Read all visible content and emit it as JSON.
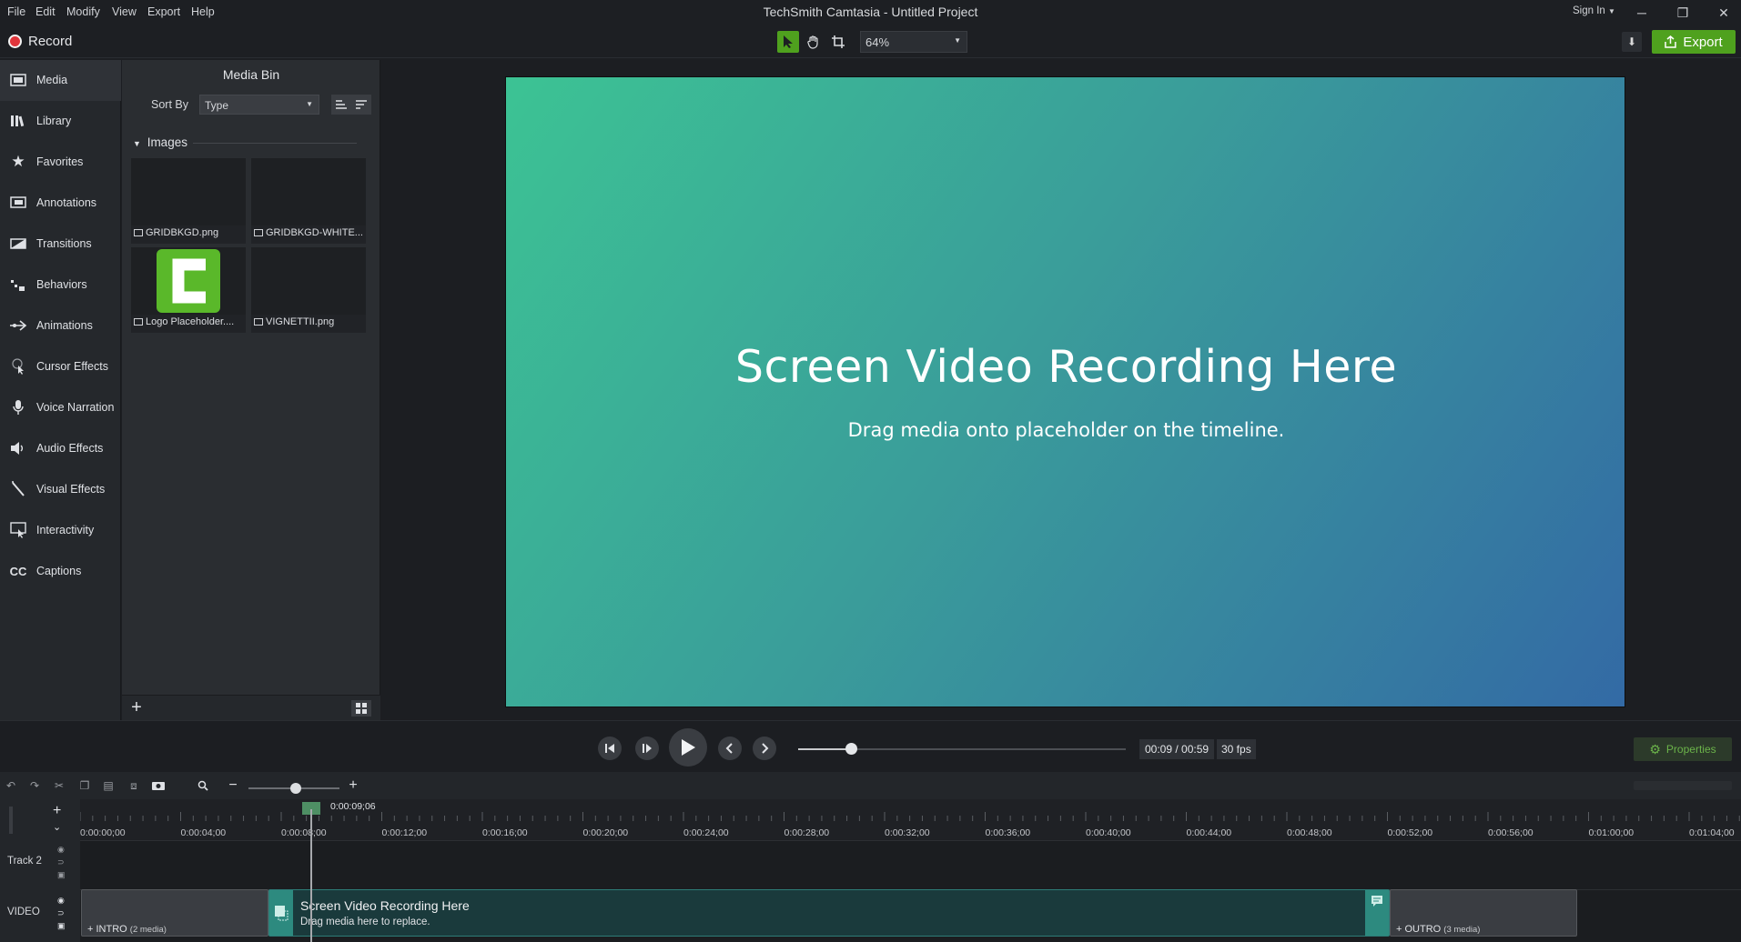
{
  "menu": [
    "File",
    "Edit",
    "Modify",
    "View",
    "Export",
    "Help"
  ],
  "app_title": "TechSmith Camtasia - Untitled Project",
  "sign_in": "Sign In",
  "record_label": "Record",
  "zoom_level": "64%",
  "export_label": "Export",
  "nav": [
    {
      "label": "Media",
      "icon": "film-icon",
      "active": true
    },
    {
      "label": "Library",
      "icon": "books-icon"
    },
    {
      "label": "Favorites",
      "icon": "star-icon"
    },
    {
      "label": "Annotations",
      "icon": "annotation-icon"
    },
    {
      "label": "Transitions",
      "icon": "transition-icon"
    },
    {
      "label": "Behaviors",
      "icon": "behaviors-icon"
    },
    {
      "label": "Animations",
      "icon": "arrow-right-icon"
    },
    {
      "label": "Cursor Effects",
      "icon": "cursor-icon"
    },
    {
      "label": "Voice Narration",
      "icon": "microphone-icon"
    },
    {
      "label": "Audio Effects",
      "icon": "speaker-icon"
    },
    {
      "label": "Visual Effects",
      "icon": "wand-icon"
    },
    {
      "label": "Interactivity",
      "icon": "interactivity-icon"
    },
    {
      "label": "Captions",
      "icon": "cc-icon"
    }
  ],
  "media_bin": {
    "title": "Media Bin",
    "sort_by_label": "Sort By",
    "sort_by_value": "Type",
    "group_label": "Images",
    "items": [
      {
        "name": "GRIDBKGD.png"
      },
      {
        "name": "GRIDBKGD-WHITE..."
      },
      {
        "name": "Logo Placeholder...."
      },
      {
        "name": "VIGNETTII.png"
      }
    ]
  },
  "canvas": {
    "headline": "Screen Video Recording Here",
    "subtext": "Drag media onto placeholder on the timeline.",
    "gradient_start": "#3cc394",
    "gradient_end": "#336aa5"
  },
  "playback": {
    "time": "00:09 / 00:59",
    "fps": "30 fps",
    "progress": 0.16,
    "properties_label": "Properties"
  },
  "timeline": {
    "zoom_fraction": 0.52,
    "playhead_time": "0:00:09;06",
    "ticks": [
      "0:00:00;00",
      "0:00:04;00",
      "0:00:08;00",
      "0:00:12;00",
      "0:00:16;00",
      "0:00:20;00",
      "0:00:24;00",
      "0:00:28;00",
      "0:00:32;00",
      "0:00:36;00",
      "0:00:40;00",
      "0:00:44;00",
      "0:00:48;00",
      "0:00:52;00",
      "0:00:56;00",
      "0:01:00;00",
      "0:01:04;00"
    ],
    "tracks": [
      "Track 2",
      "VIDEO"
    ],
    "intro_label": "INTRO",
    "intro_count": "(2 media)",
    "outro_label": "OUTRO",
    "outro_count": "(3 media)",
    "clip_title": "Screen Video Recording Here",
    "clip_subtitle": "Drag media here to replace."
  },
  "accent_color": "#4fa11e"
}
